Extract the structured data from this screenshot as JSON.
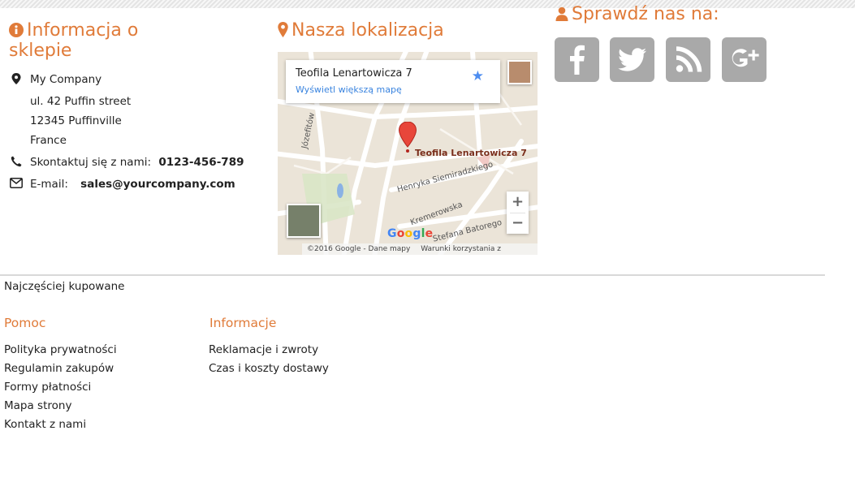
{
  "store_info": {
    "title": "Informacja o sklepie",
    "company": "My Company",
    "street": "ul. 42 Puffin street",
    "city": "12345 Puffinville",
    "country": "France",
    "contact_label": "Skontaktuj się z nami:",
    "phone": "0123-456-789",
    "email_label": "E-mail:",
    "email": "sales@yourcompany.com"
  },
  "location": {
    "title": "Nasza lokalizacja",
    "place_name": "Teofila Lenartowicza 7",
    "bigger_map_link": "Wyświetl większą mapę",
    "marker_label": "Teofila Lenartowicza 7",
    "streets": [
      "Józefitów",
      "Henryka Siemiradzkiego",
      "Kremerowska",
      "Stefana Batorego"
    ],
    "google_logo": "Google",
    "copyright": "©2016 Google - Dane mapy",
    "terms": "Warunki korzystania z programu",
    "zoom_in": "+",
    "zoom_out": "−"
  },
  "social": {
    "title": "Sprawdź nas na:",
    "buttons": [
      {
        "icon": "facebook-icon"
      },
      {
        "icon": "twitter-icon"
      },
      {
        "icon": "rss-icon"
      },
      {
        "icon": "google-plus-icon"
      }
    ],
    "color": "#a9a9a9"
  },
  "bestsellers": "Najczęściej kupowane",
  "help": {
    "title": "Pomoc",
    "links": [
      "Polityka prywatności",
      "Regulamin zakupów",
      "Formy płatności",
      "Mapa strony",
      "Kontakt z nami"
    ]
  },
  "information": {
    "title": "Informacje",
    "links": [
      "Reklamacje i zwroty",
      "Czas i koszty dostawy"
    ]
  },
  "colors": {
    "accent": "#e07b39",
    "link_blue": "#3a84df",
    "icon_gray": "#a9a9a9"
  }
}
